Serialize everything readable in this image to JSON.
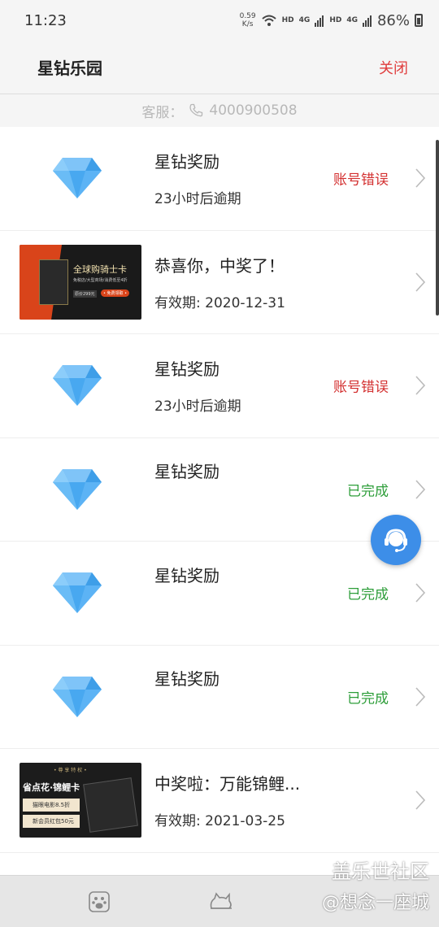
{
  "status_bar": {
    "time": "11:23",
    "netspeed_value": "0.59",
    "netspeed_unit": "K/s",
    "hd1": "HD",
    "net1": "4G",
    "hd2": "HD",
    "net2": "4G",
    "battery": "86%"
  },
  "header": {
    "title": "星钻乐园",
    "close_label": "关闭"
  },
  "service": {
    "label": "客服：",
    "phone": "4000900508",
    "icon": "phone-icon"
  },
  "rows": [
    {
      "type": "diamond",
      "title": "星钻奖励",
      "subtitle": "23小时后逾期",
      "status": "账号错误",
      "status_kind": "error"
    },
    {
      "type": "card-knight",
      "title": "恭喜你，中奖了！",
      "subtitle": "有效期: 2020-12-31",
      "status": "",
      "status_kind": "",
      "card_text": "全球购骑士卡",
      "card_sub": "免税店/大型商场/消费低至4折",
      "card_btn": "• 免费领取 •",
      "card_price": "原价299元"
    },
    {
      "type": "diamond",
      "title": "星钻奖励",
      "subtitle": "23小时后逾期",
      "status": "账号错误",
      "status_kind": "error"
    },
    {
      "type": "diamond",
      "title": "星钻奖励",
      "subtitle": "",
      "status": "已完成",
      "status_kind": "done"
    },
    {
      "type": "diamond",
      "title": "星钻奖励",
      "subtitle": "",
      "status": "已完成",
      "status_kind": "done"
    },
    {
      "type": "diamond",
      "title": "星钻奖励",
      "subtitle": "",
      "status": "已完成",
      "status_kind": "done"
    },
    {
      "type": "card-koi",
      "title": "中奖啦：万能锦鲤...",
      "subtitle": "有效期: 2021-03-25",
      "status": "",
      "status_kind": "",
      "card_text": "省点花·锦鲤卡",
      "card_line1": "猫眼电影8.5折",
      "card_line2": "新会员红包50元",
      "card_top": "• 尊 享 特 权 •"
    }
  ],
  "watermark": {
    "line1": "盖乐世社区",
    "line2": "@想念一座城"
  },
  "colors": {
    "error": "#d32f2f",
    "done": "#2e9e3a",
    "close": "#e03c3c",
    "fab": "#3d8ee8"
  }
}
